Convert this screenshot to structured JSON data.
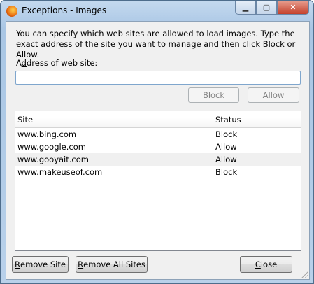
{
  "window": {
    "title": "Exceptions - Images",
    "icon": "firefox-icon",
    "controls": [
      "minimize",
      "maximize",
      "close"
    ]
  },
  "description": "You can specify which web sites are allowed to load images. Type the exact address of the site you want to manage and then click Block or Allow.",
  "address": {
    "label_pre": "A",
    "label_ul": "d",
    "label_post": "dress of web site:",
    "value": ""
  },
  "buttons": {
    "block": {
      "ul": "B",
      "rest": "lock"
    },
    "allow": {
      "ul": "A",
      "rest": "llow"
    },
    "remove_site": {
      "ul": "R",
      "rest": "emove Site"
    },
    "remove_all": {
      "ul": "R",
      "rest": "emove All Sites"
    },
    "close": {
      "ul": "C",
      "rest": "lose"
    }
  },
  "table": {
    "columns": [
      "Site",
      "Status"
    ],
    "rows": [
      {
        "site": "www.bing.com",
        "status": "Block"
      },
      {
        "site": "www.google.com",
        "status": "Allow"
      },
      {
        "site": "www.gooyait.com",
        "status": "Allow"
      },
      {
        "site": "www.makeuseof.com",
        "status": "Block"
      }
    ]
  }
}
